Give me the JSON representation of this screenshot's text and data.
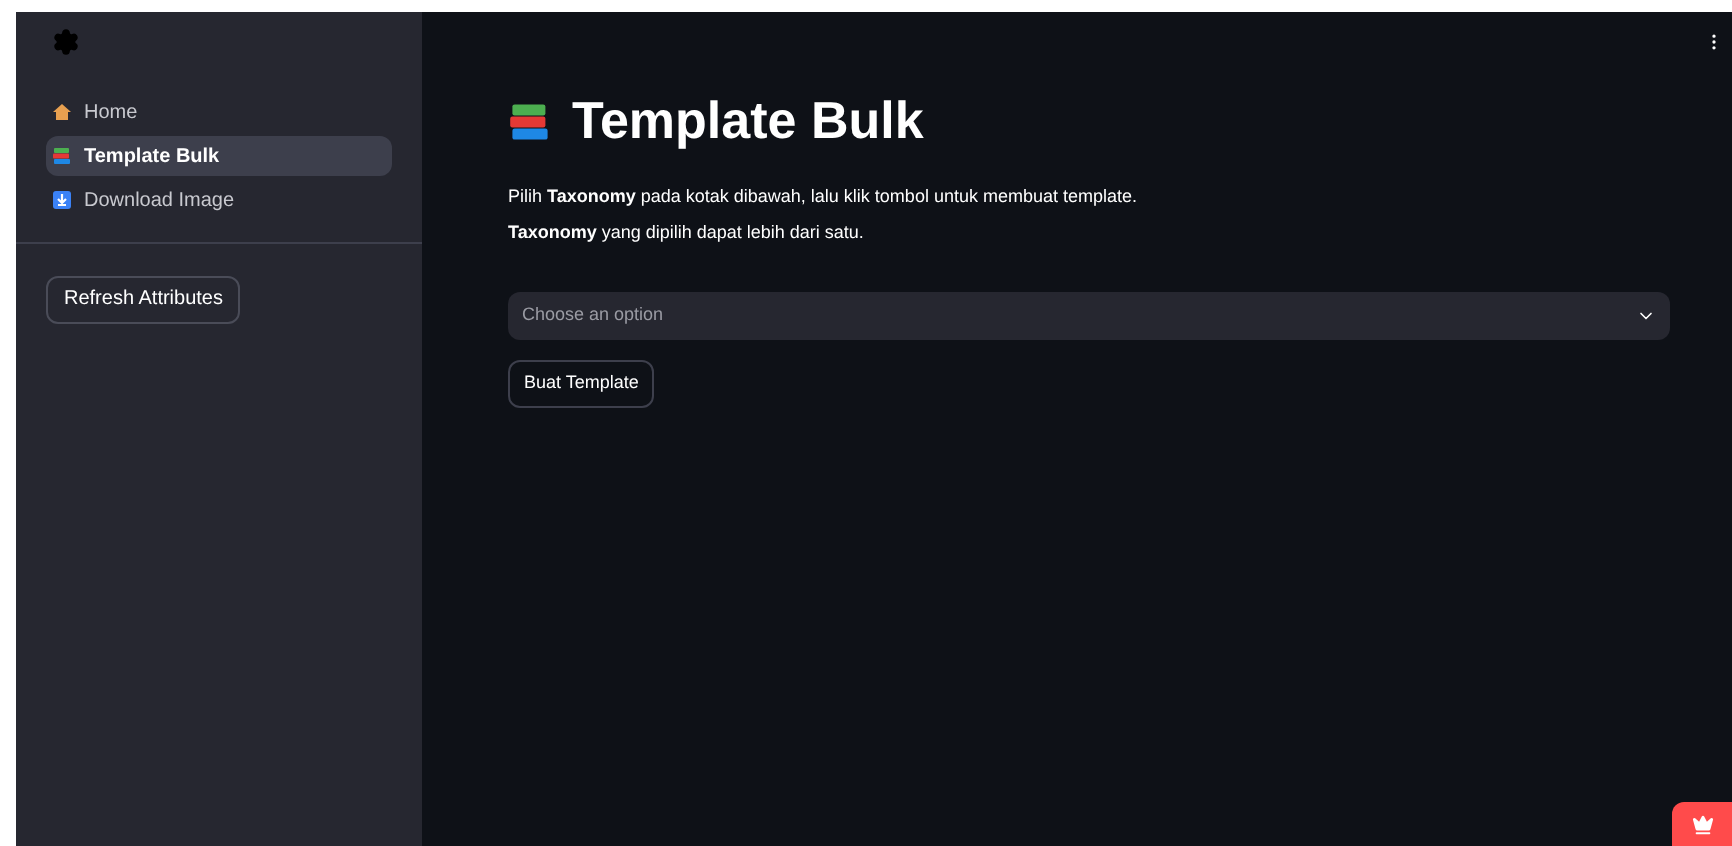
{
  "sidebar": {
    "items": [
      {
        "label": "Home",
        "kind": "house",
        "selected": false
      },
      {
        "label": "Template Bulk",
        "kind": "books",
        "selected": true
      },
      {
        "label": "Download Image",
        "kind": "download",
        "selected": false
      }
    ],
    "button": "Refresh Attributes"
  },
  "main": {
    "title": "Template Bulk",
    "paragraphs": [
      "Pilih **Taxonomy** pada kotak dibawah, lalu klik tombol untuk membuat template.",
      "**Taxonomy** yang dipilih dapat lebih dari satu."
    ],
    "select": {
      "placeholder": "Choose an option"
    },
    "button": "Buat Template"
  }
}
